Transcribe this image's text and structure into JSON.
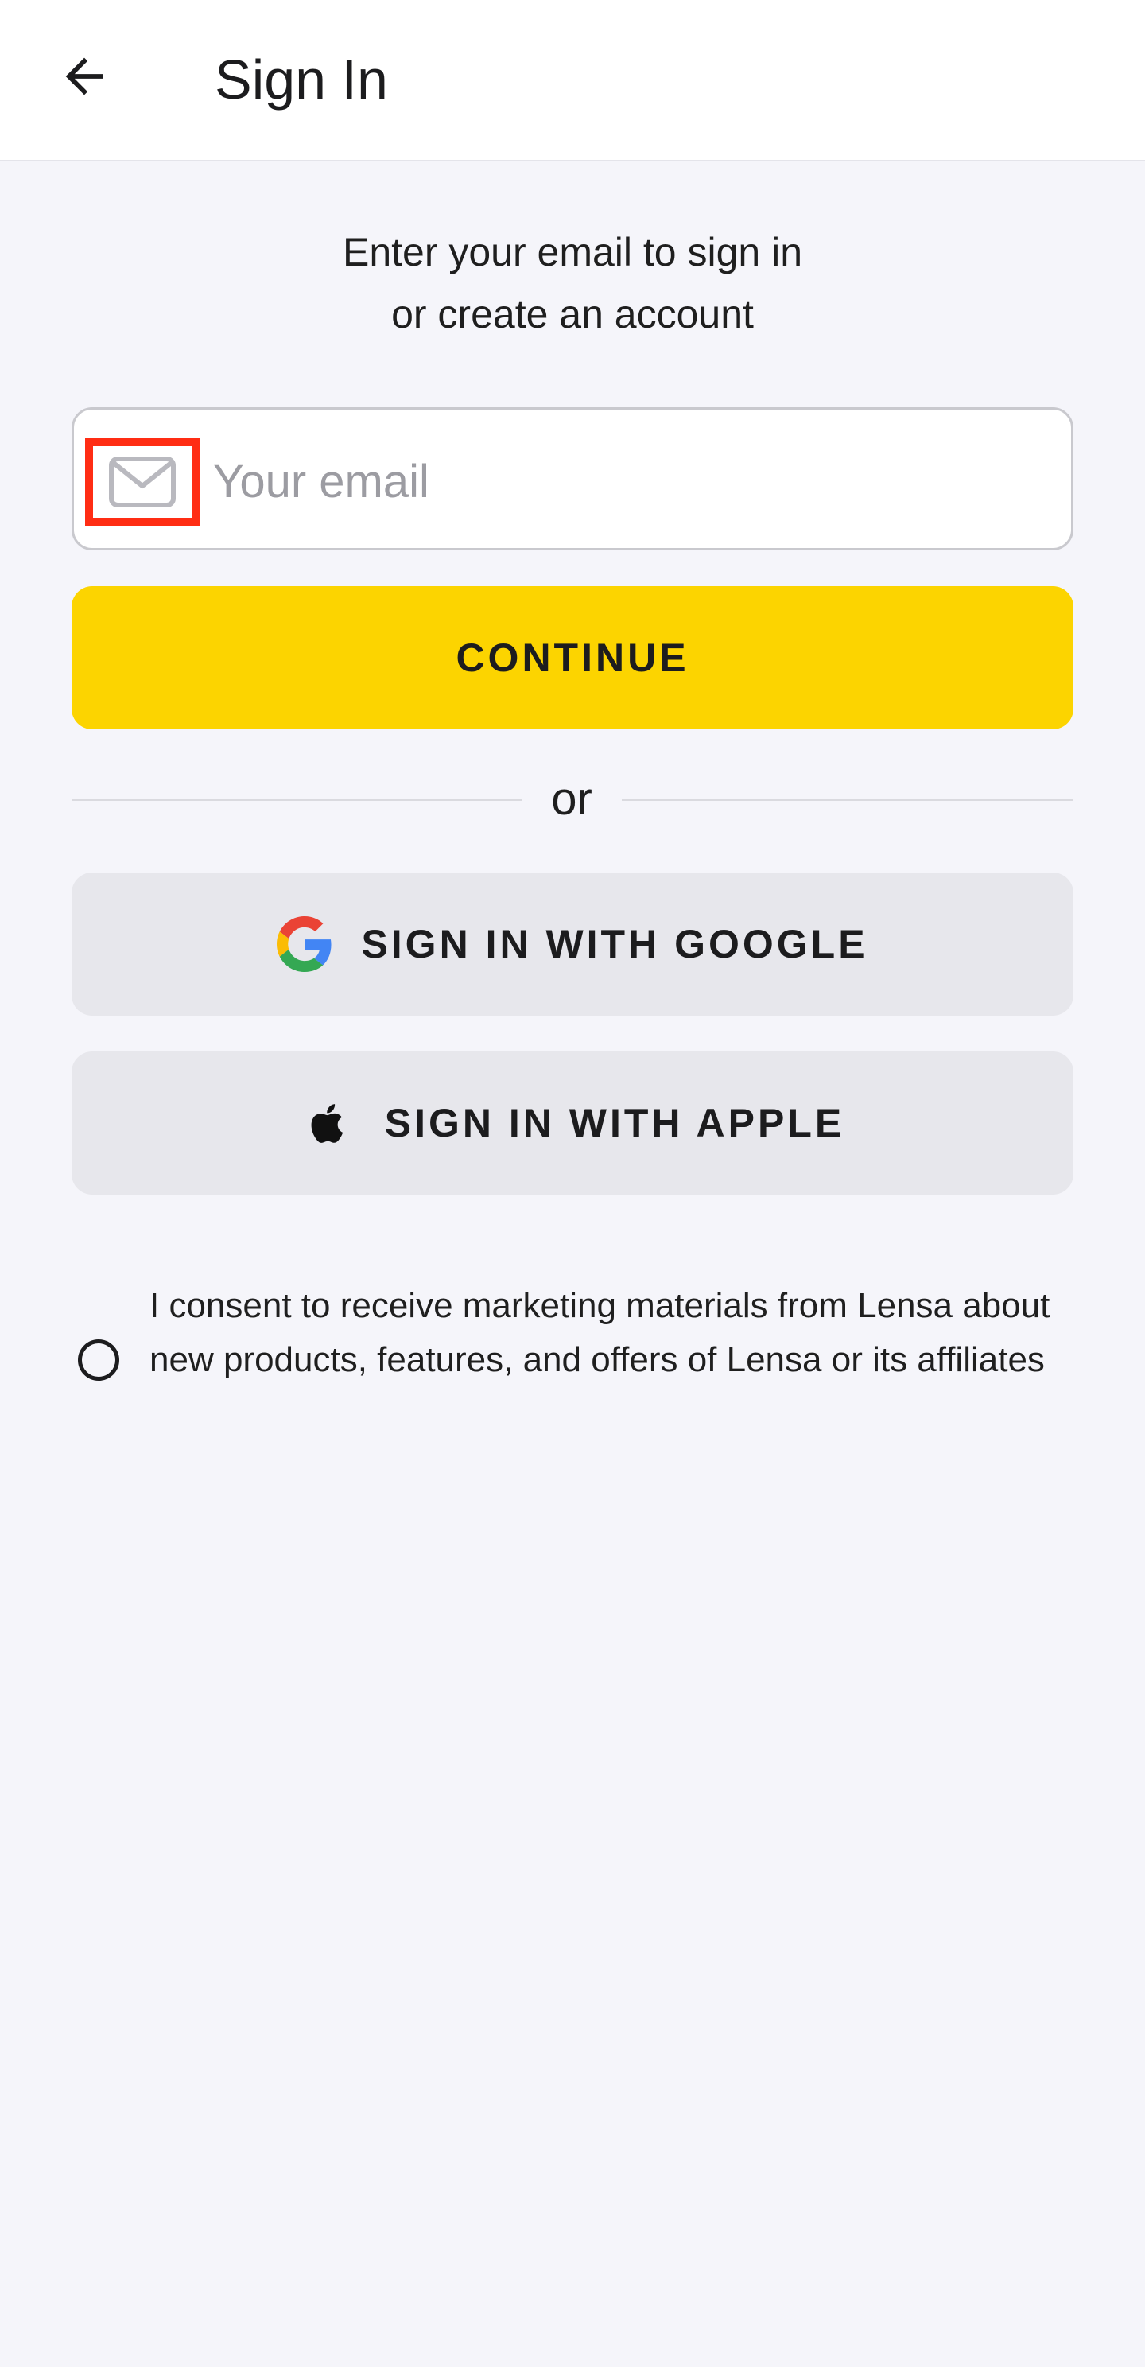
{
  "header": {
    "title": "Sign In",
    "back_icon": "arrow-left-icon"
  },
  "intro": {
    "line1": "Enter your email to sign in",
    "line2": "or create an account"
  },
  "email_field": {
    "placeholder": "Your email",
    "value": "",
    "icon": "mail-icon"
  },
  "continue_button": {
    "label": "CONTINUE",
    "color": "#fcd400"
  },
  "divider": {
    "label": "or"
  },
  "google_button": {
    "label": "SIGN IN WITH GOOGLE",
    "icon": "google-icon"
  },
  "apple_button": {
    "label": "SIGN IN WITH APPLE",
    "icon": "apple-icon"
  },
  "consent": {
    "text": "I consent to receive marketing materials from Lensa about new products, features, and offers of Lensa or its affiliates",
    "checked": false
  },
  "colors": {
    "background": "#f5f5fa",
    "highlight_box": "#ff2d14",
    "secondary_button": "#e7e7ec"
  }
}
